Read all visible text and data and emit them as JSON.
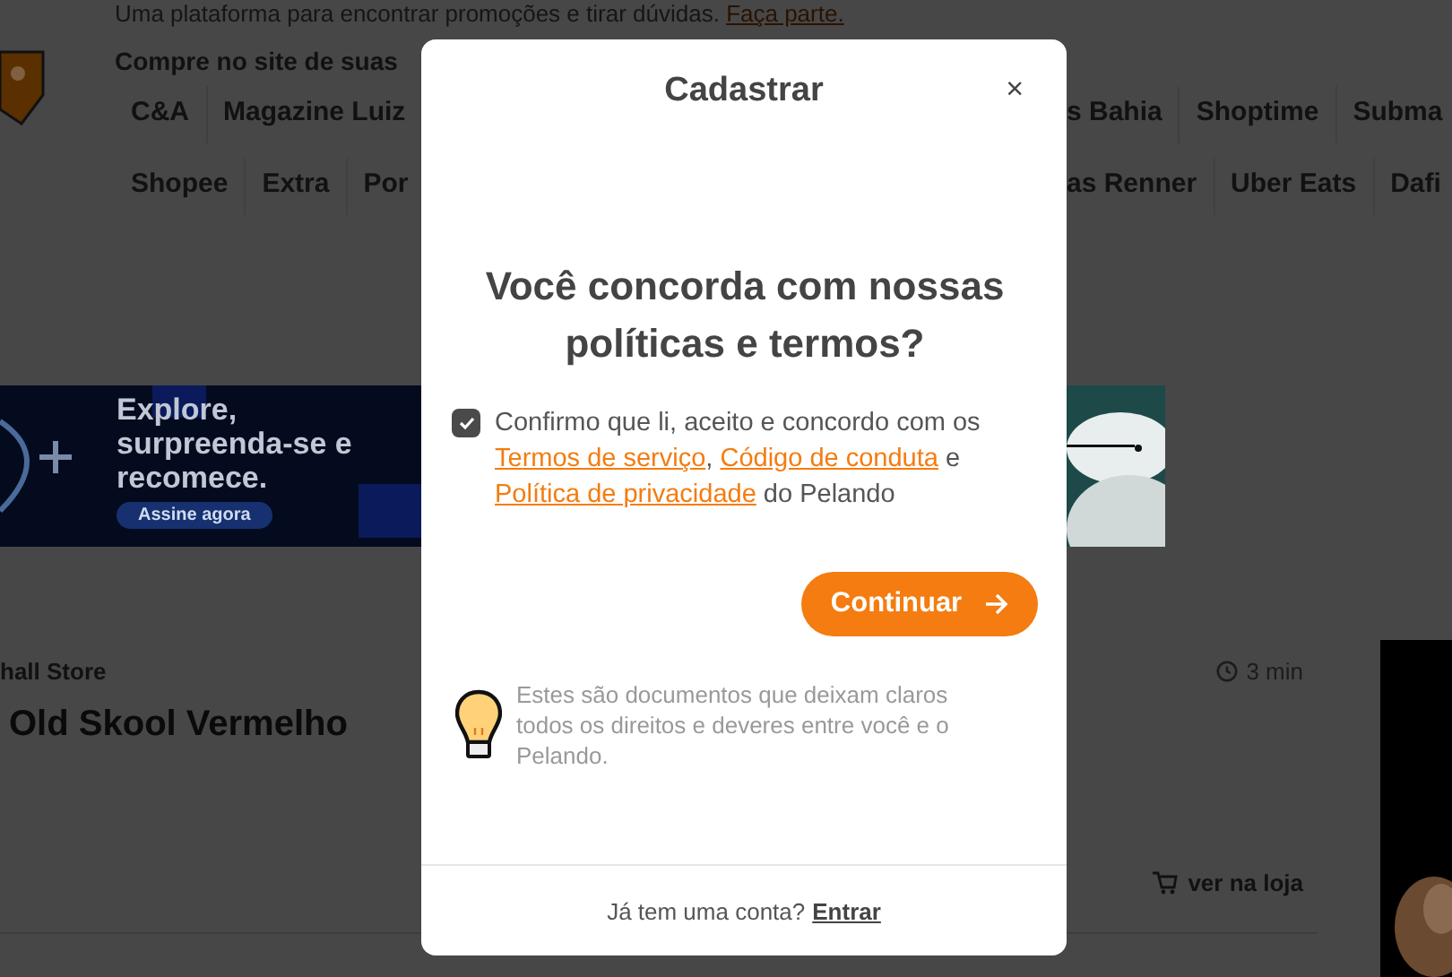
{
  "page": {
    "tagline": "Uma plataforma para encontrar promoções e tirar dúvidas.",
    "tagline_link": "Faça parte.",
    "stores_heading": "Compre no site de suas",
    "store_rows": [
      {
        "left": [
          "C&A",
          "Magazine Luiz"
        ],
        "right": [
          "s Bahia",
          "Shoptime",
          "Subma"
        ]
      },
      {
        "left": [
          "Shopee",
          "Extra",
          "Por"
        ],
        "right": [
          "as Renner",
          "Uber Eats",
          "Dafi"
        ]
      }
    ],
    "banner": {
      "headline": "Explore, surpreenda-se e recomece.",
      "button": "Assine agora"
    },
    "deal": {
      "store": "hall Store",
      "title": "Old Skool Vermelho",
      "time": "3 min",
      "store_link": "ver na loja"
    }
  },
  "modal": {
    "title": "Cadastrar",
    "close": "×",
    "question": "Você concorda com nossas políticas e termos?",
    "consent": {
      "checked": true,
      "parts": [
        {
          "kind": "text",
          "text": "Confirmo que li, aceito e concordo com os "
        },
        {
          "kind": "link",
          "text": "Termos de serviço"
        },
        {
          "kind": "text",
          "text": ", "
        },
        {
          "kind": "link",
          "text": "Código de conduta"
        },
        {
          "kind": "text",
          "text": " e "
        },
        {
          "kind": "link",
          "text": "Política de privacidade"
        },
        {
          "kind": "text",
          "text": " do Pelando"
        }
      ]
    },
    "button": "Continuar",
    "tip": "Estes são documentos que deixam claros todos os direitos e deveres entre você e o Pelando.",
    "footer_text": "Já tem uma conta?",
    "footer_link": "Entrar"
  }
}
